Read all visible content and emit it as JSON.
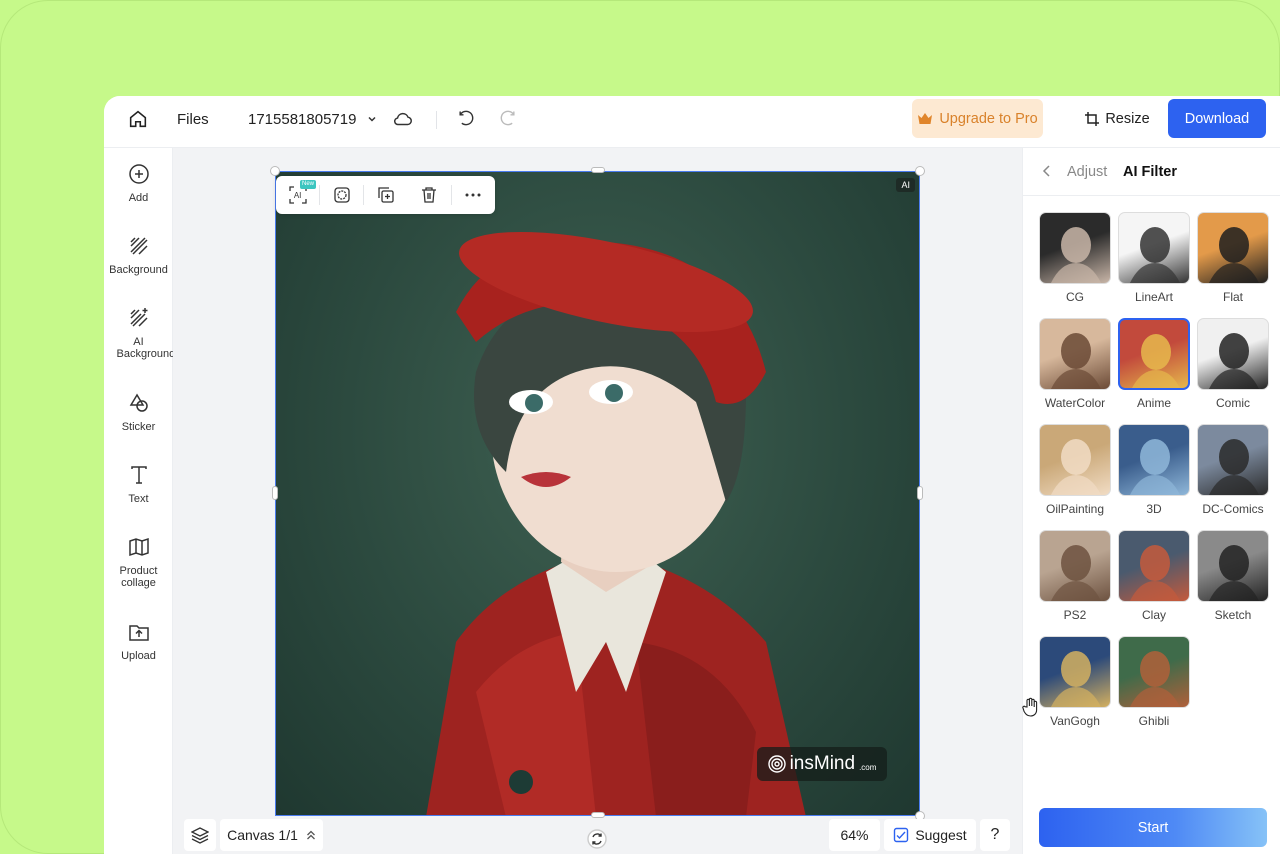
{
  "topbar": {
    "files_label": "Files",
    "filename": "1715581805719",
    "upgrade_label": "Upgrade to Pro",
    "resize_label": "Resize",
    "download_label": "Download"
  },
  "sidebar": {
    "items": [
      {
        "label": "Add",
        "icon": "plus-circle-icon"
      },
      {
        "label": "Background",
        "icon": "hatch-icon"
      },
      {
        "label": "AI Background",
        "icon": "ai-hatch-icon"
      },
      {
        "label": "Sticker",
        "icon": "shapes-icon"
      },
      {
        "label": "Text",
        "icon": "text-icon"
      },
      {
        "label": "Product collage",
        "icon": "map-icon"
      },
      {
        "label": "Upload",
        "icon": "upload-icon"
      }
    ]
  },
  "canvas": {
    "ai_tag": "AI",
    "new_badge": "New",
    "ai_button_text": "AI",
    "watermark_brand": "insMind",
    "watermark_suffix": ".com"
  },
  "bottombar": {
    "canvas_label": "Canvas 1/1",
    "zoom": "64%",
    "suggest_label": "Suggest",
    "help_label": "?"
  },
  "panel": {
    "tab_adjust": "Adjust",
    "tab_filter": "AI Filter",
    "filters": [
      {
        "label": "CG",
        "selected": false
      },
      {
        "label": "LineArt",
        "selected": false
      },
      {
        "label": "Flat",
        "selected": false
      },
      {
        "label": "WaterColor",
        "selected": false
      },
      {
        "label": "Anime",
        "selected": true
      },
      {
        "label": "Comic",
        "selected": false
      },
      {
        "label": "OilPainting",
        "selected": false
      },
      {
        "label": "3D",
        "selected": false
      },
      {
        "label": "DC-Comics",
        "selected": false
      },
      {
        "label": "PS2",
        "selected": false
      },
      {
        "label": "Clay",
        "selected": false
      },
      {
        "label": "Sketch",
        "selected": false
      },
      {
        "label": "VanGogh",
        "selected": false
      },
      {
        "label": "Ghibli",
        "selected": false
      }
    ],
    "start_label": "Start"
  },
  "colors": {
    "accent": "#2d62f0",
    "upgrade_bg": "#fde9d2",
    "upgrade_text": "#d9822b",
    "page_bg": "#c6f98a"
  }
}
